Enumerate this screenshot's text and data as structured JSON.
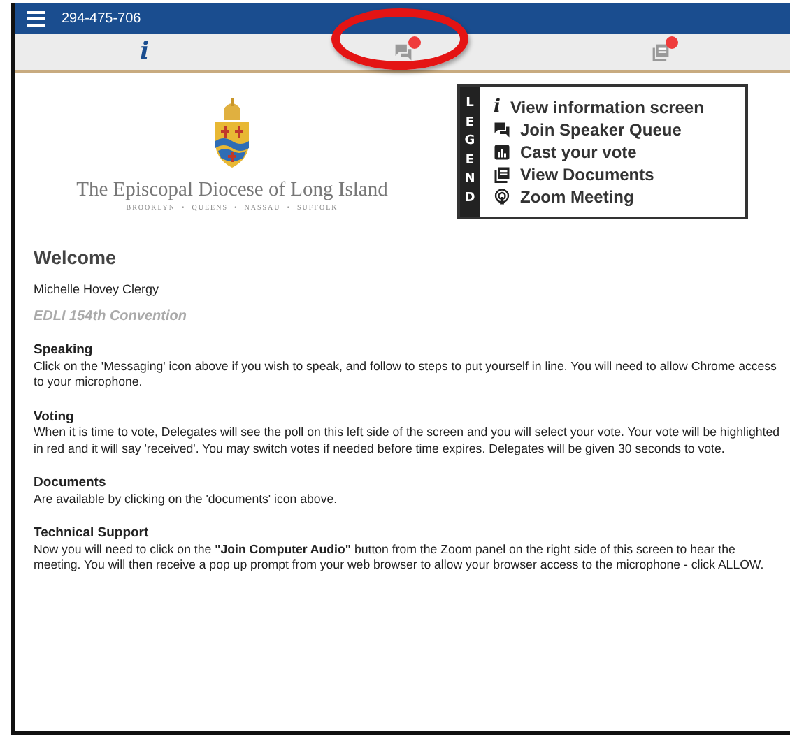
{
  "header": {
    "meeting_id": "294-475-706"
  },
  "tabs": [
    {
      "kind": "info",
      "label": "i",
      "selected": true,
      "badge": false,
      "circled": false
    },
    {
      "kind": "messages",
      "selected": false,
      "badge": true,
      "circled": true
    },
    {
      "kind": "documents",
      "selected": false,
      "badge": true,
      "circled": false
    }
  ],
  "logo": {
    "name": "The Episcopal Diocese of Long Island",
    "places": "BROOKLYN  •  QUEENS  •  NASSAU  •  SUFFOLK"
  },
  "legend": {
    "title": "LEGEND",
    "items": [
      {
        "kind": "info",
        "icon_text": "i",
        "label": "View information screen"
      },
      {
        "kind": "chat",
        "label": "Join Speaker Queue"
      },
      {
        "kind": "vote",
        "label": "Cast your vote"
      },
      {
        "kind": "documents",
        "label": "View Documents"
      },
      {
        "kind": "zoom",
        "label": "Zoom Meeting"
      }
    ]
  },
  "welcome": {
    "title": "Welcome",
    "user": "Michelle Hovey Clergy",
    "event": "EDLI 154th Convention"
  },
  "sections": [
    {
      "heading": "Speaking",
      "text": "Click on the 'Messaging' icon above if you wish to speak, and follow to steps to put yourself in line. You will need to allow Chrome access to your microphone."
    },
    {
      "heading": "Voting",
      "text": "When it is time to vote, Delegates will see the poll on this left side of the screen and you will select your vote. Your vote will be highlighted in red and it will say 'received'. You may switch votes if needed before time expires. Delegates will be given 30 seconds to vote."
    },
    {
      "heading": "Documents",
      "text": "Are available by clicking on the 'documents' icon above."
    },
    {
      "heading": "Technical Support",
      "text": "Now you will need to click on the **\"Join Computer Audio\"** button from the Zoom panel on the right side of this screen to hear the meeting. You will then receive a pop up prompt from your web browser to allow your browser access to the microphone - click ALLOW."
    }
  ]
}
